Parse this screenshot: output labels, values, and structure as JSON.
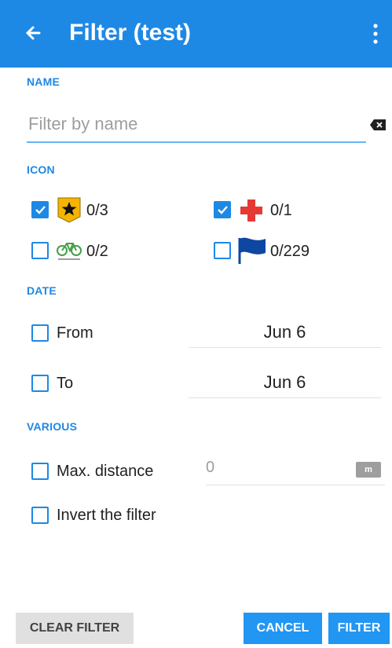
{
  "appbar": {
    "title": "Filter (test)"
  },
  "sections": {
    "name": "NAME",
    "icon": "ICON",
    "date": "DATE",
    "various": "VARIOUS"
  },
  "name_filter": {
    "placeholder": "Filter by name",
    "value": ""
  },
  "icon_filters": [
    {
      "icon": "star-marker-icon",
      "count": "0/3",
      "checked": true
    },
    {
      "icon": "red-cross-icon",
      "count": "0/1",
      "checked": true
    },
    {
      "icon": "bicycle-icon",
      "count": "0/2",
      "checked": false
    },
    {
      "icon": "blue-flag-icon",
      "count": "0/229",
      "checked": false
    }
  ],
  "date": {
    "from": {
      "label": "From",
      "value": "Jun 6",
      "checked": false
    },
    "to": {
      "label": "To",
      "value": "Jun 6",
      "checked": false
    }
  },
  "various": {
    "max_distance": {
      "label": "Max. distance",
      "value": "0",
      "unit": "m",
      "checked": false
    },
    "invert": {
      "label": "Invert the filter",
      "checked": false
    }
  },
  "buttons": {
    "clear": "CLEAR FILTER",
    "cancel": "CANCEL",
    "filter": "FILTER"
  },
  "colors": {
    "accent": "#1e88e5",
    "appbar": "#1e88e5",
    "button": "#2196f3"
  }
}
